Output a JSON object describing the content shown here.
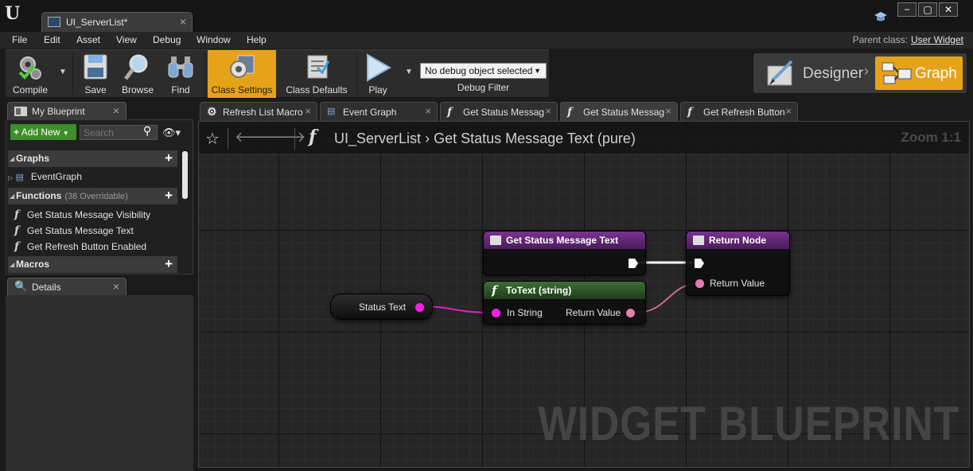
{
  "window": {
    "doc_tab_title": "UI_ServerList*",
    "minimize": "−",
    "maximize": "▢",
    "close": "✕"
  },
  "menu": {
    "items": [
      "File",
      "Edit",
      "Asset",
      "View",
      "Debug",
      "Window",
      "Help"
    ],
    "parent_class_label": "Parent class:",
    "parent_class_value": "User Widget"
  },
  "toolbar": {
    "compile": "Compile",
    "save": "Save",
    "browse": "Browse",
    "find": "Find",
    "class_settings": "Class Settings",
    "class_defaults": "Class Defaults",
    "play": "Play",
    "debug_select": "No debug object selected",
    "debug_filter": "Debug Filter"
  },
  "mode": {
    "designer": "Designer",
    "graph": "Graph"
  },
  "my_blueprint": {
    "tab_title": "My Blueprint",
    "add_new": "Add New",
    "search_placeholder": "Search",
    "graphs_header": "Graphs",
    "graphs": [
      "EventGraph"
    ],
    "functions_header": "Functions",
    "functions_sub": "(38 Overridable)",
    "functions": [
      "Get Status Message Visibility",
      "Get Status Message Text",
      "Get Refresh Button Enabled"
    ],
    "macros_header": "Macros"
  },
  "details": {
    "tab_title": "Details"
  },
  "graph_tabs": [
    {
      "label": "Refresh List Macro",
      "icon": "gear-icon"
    },
    {
      "label": "Event Graph",
      "icon": "graph-icon"
    },
    {
      "label": "Get Status Messag",
      "icon": "function-icon"
    },
    {
      "label": "Get Status Messag",
      "icon": "function-icon",
      "active": true
    },
    {
      "label": "Get Refresh Button",
      "icon": "function-icon"
    }
  ],
  "graph": {
    "breadcrumb_root": "UI_ServerList",
    "breadcrumb_sep": "›",
    "breadcrumb_current": "Get Status Message Text (pure)",
    "zoom": "Zoom 1:1",
    "watermark": "WIDGET BLUEPRINT"
  },
  "nodes": {
    "entry": {
      "title": "Get Status Message Text",
      "header_color": "#6b2a7e"
    },
    "return": {
      "title": "Return Node",
      "pin_label": "Return Value",
      "header_color": "#6b2a7e"
    },
    "totext": {
      "title": "ToText (string)",
      "pin_in": "In String",
      "pin_out": "Return Value",
      "header_color": "#2f5a2a"
    },
    "variable": {
      "title": "Status Text",
      "pin_color": "#ff1ee6"
    }
  },
  "colors": {
    "accent": "#e6a31a",
    "string_pin": "#ff1ee6",
    "text_pin": "#e07fa8",
    "add_new": "#3e8e2a"
  }
}
